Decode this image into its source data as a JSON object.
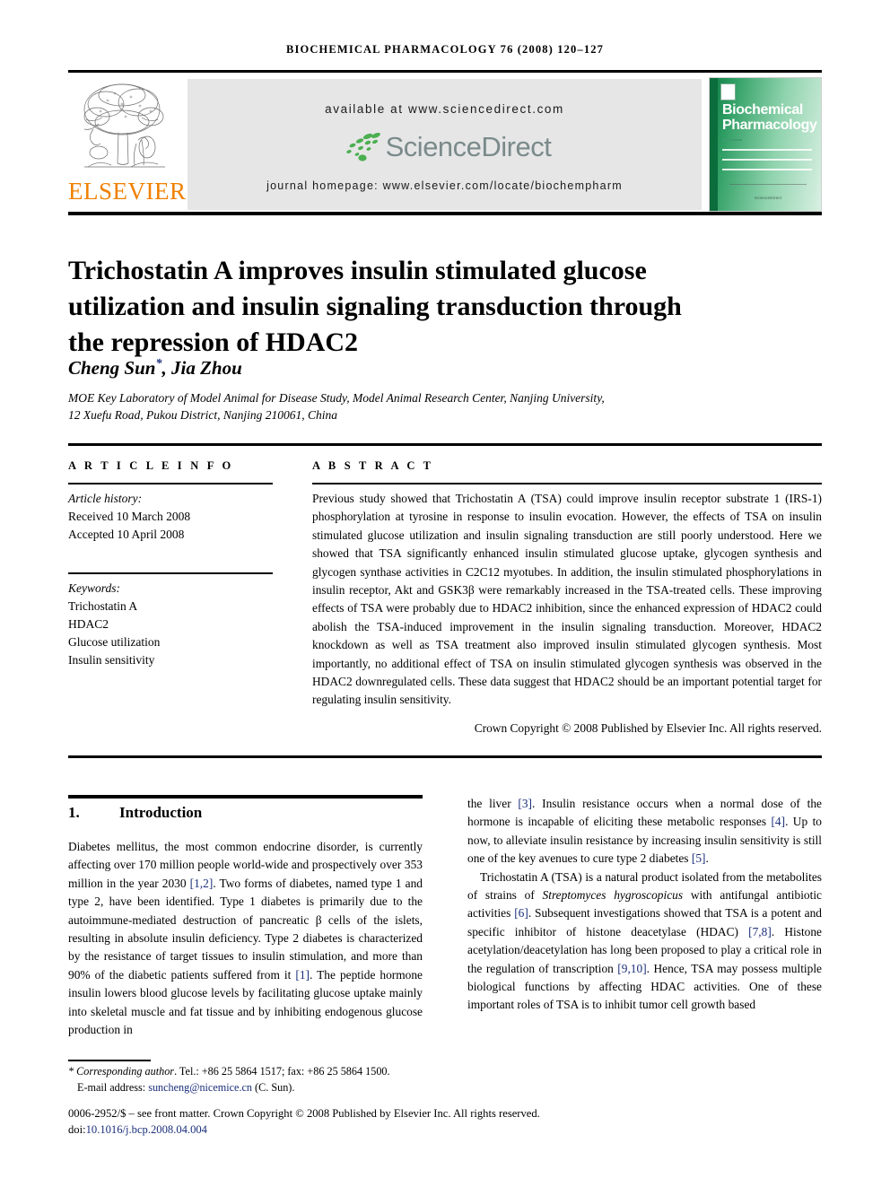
{
  "running_head": "Biochemical Pharmacology 76 (2008) 120–127",
  "masthead": {
    "publisher_logo_name": "elsevier-tree-logo",
    "publisher_wordmark": "ELSEVIER",
    "available_at": "available at www.sciencedirect.com",
    "sciencedirect_wordmark": "ScienceDirect",
    "journal_homepage": "journal homepage: www.elsevier.com/locate/biochempharm",
    "cover": {
      "title_line1": "Biochemical",
      "title_line2": "Pharmacology",
      "footer_text": "ScienceDirect"
    }
  },
  "article": {
    "title": "Trichostatin A improves insulin stimulated glucose utilization and insulin signaling transduction through the repression of HDAC2",
    "authors": "Cheng Sun",
    "author_marker": "*",
    "authors_rest": ", Jia Zhou",
    "affiliation_line1": "MOE Key Laboratory of Model Animal for Disease Study, Model Animal Research Center, Nanjing University,",
    "affiliation_line2": "12 Xuefu Road, Pukou District, Nanjing 210061, China"
  },
  "article_info": {
    "heading": "A R T I C L E  I N F O",
    "history_label": "Article history:",
    "received": "Received 10 March 2008",
    "accepted": "Accepted 10 April 2008",
    "keywords_label": "Keywords:",
    "keywords": [
      "Trichostatin A",
      "HDAC2",
      "Glucose utilization",
      "Insulin sensitivity"
    ]
  },
  "abstract": {
    "heading": "A B S T R A C T",
    "text": "Previous study showed that Trichostatin A (TSA) could improve insulin receptor substrate 1 (IRS-1) phosphorylation at tyrosine in response to insulin evocation. However, the effects of TSA on insulin stimulated glucose utilization and insulin signaling transduction are still poorly understood. Here we showed that TSA significantly enhanced insulin stimulated glucose uptake, glycogen synthesis and glycogen synthase activities in C2C12 myotubes. In addition, the insulin stimulated phosphorylations in insulin receptor, Akt and GSK3β were remarkably increased in the TSA-treated cells. These improving effects of TSA were probably due to HDAC2 inhibition, since the enhanced expression of HDAC2 could abolish the TSA-induced improvement in the insulin signaling transduction. Moreover, HDAC2 knockdown as well as TSA treatment also improved insulin stimulated glycogen synthesis. Most importantly, no additional effect of TSA on insulin stimulated glycogen synthesis was observed in the HDAC2 downregulated cells. These data suggest that HDAC2 should be an important potential target for regulating insulin sensitivity.",
    "copyright": "Crown Copyright © 2008 Published by Elsevier Inc. All rights reserved."
  },
  "introduction": {
    "number": "1.",
    "title": "Introduction",
    "left_p1_a": "Diabetes mellitus, the most common endocrine disorder, is currently affecting over 170 million people world-wide and prospectively over 353 million in the year 2030 ",
    "left_ref_1": "[1,2]",
    "left_p1_b": ". Two forms of diabetes, named type 1 and type 2, have been identified. Type 1 diabetes is primarily due to the autoimmune-mediated destruction of pancreatic β cells of the islets, resulting in absolute insulin deficiency. Type 2 diabetes is characterized by the resistance of target tissues to insulin stimulation, and more than 90% of the diabetic patients suffered from it ",
    "left_ref_2": "[1]",
    "left_p1_c": ". The peptide hormone insulin lowers blood glucose levels by facilitating glucose uptake mainly into skeletal muscle and fat tissue and by inhibiting endogenous glucose production in",
    "right_p1_a": "the liver ",
    "right_ref_3": "[3]",
    "right_p1_b": ". Insulin resistance occurs when a normal dose of the hormone is incapable of eliciting these metabolic responses ",
    "right_ref_4": "[4]",
    "right_p1_c": ". Up to now, to alleviate insulin resistance by increasing insulin sensitivity is still one of the key avenues to cure type 2 diabetes ",
    "right_ref_5": "[5]",
    "right_p1_d": ".",
    "right_p2_a": "Trichostatin A (TSA) is a natural product isolated from the metabolites of strains of ",
    "right_p2_italic": "Streptomyces hygroscopicus",
    "right_p2_b": " with antifungal antibiotic activities ",
    "right_ref_6": "[6]",
    "right_p2_c": ". Subsequent investigations showed that TSA is a potent and specific inhibitor of histone deacetylase (HDAC) ",
    "right_ref_78": "[7,8]",
    "right_p2_d": ". Histone acetylation/deacetylation has long been proposed to play a critical role in the regulation of transcription ",
    "right_ref_910": "[9,10]",
    "right_p2_e": ". Hence, TSA may possess multiple biological functions by affecting HDAC activities. One of these important roles of TSA is to inhibit tumor cell growth based"
  },
  "footnotes": {
    "corresponding_label": "Corresponding author",
    "corresponding_rest": ". Tel.: +86 25 5864 1517; fax: +86 25 5864 1500.",
    "email_label": "E-mail address: ",
    "email": "suncheng@nicemice.cn",
    "email_suffix": " (C. Sun).",
    "frontmatter": "0006-2952/$ – see front matter. Crown Copyright © 2008 Published by Elsevier Inc. All rights reserved.",
    "doi_label": "doi:",
    "doi": "10.1016/j.bcp.2008.04.004"
  },
  "colors": {
    "elsevier_orange": "#F08000",
    "sciencedirect_green": "#4caf50",
    "sciencedirect_gray": "#7b8a8b",
    "link_blue": "#1a2f7a",
    "band_gray": "#e6e6e6",
    "cover_green": "#0c7a43"
  }
}
